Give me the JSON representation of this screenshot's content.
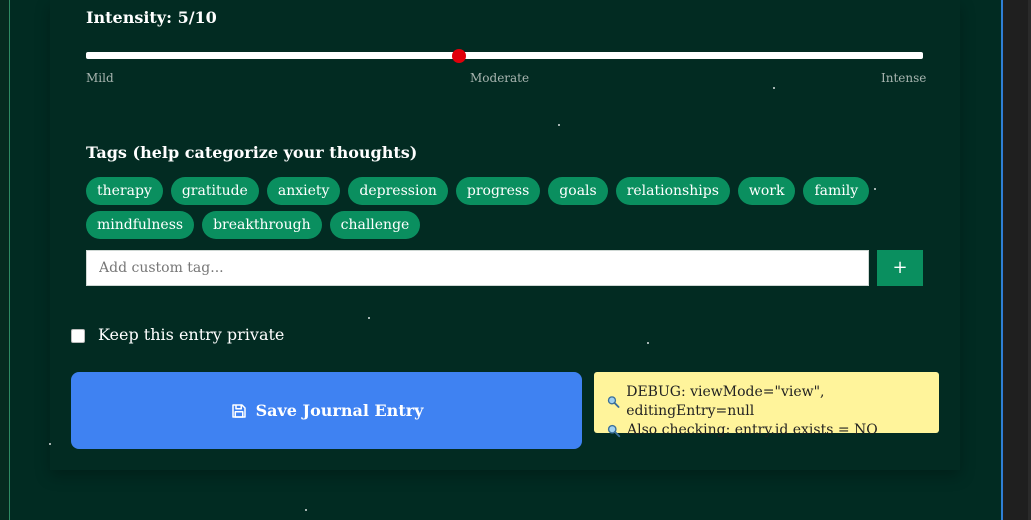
{
  "intensity": {
    "label": "Intensity: 5/10",
    "value": 5,
    "max": 10,
    "scale": {
      "min_label": "Mild",
      "mid_label": "Moderate",
      "max_label": "Intense"
    }
  },
  "tags": {
    "heading": "Tags (help categorize your thoughts)",
    "row1": [
      "therapy",
      "gratitude",
      "anxiety",
      "depression",
      "progress",
      "goals",
      "relationships",
      "work",
      "family"
    ],
    "row2": [
      "mindfulness",
      "breakthrough",
      "challenge"
    ],
    "custom_placeholder": "Add custom tag...",
    "add_label": "+"
  },
  "privacy": {
    "label": "Keep this entry private",
    "checked": false
  },
  "save": {
    "label": "Save Journal Entry",
    "icon": "floppy-disk-icon"
  },
  "debug": {
    "line1": "DEBUG: viewMode=\"view\", editingEntry=null",
    "line2": "Also checking: entry.id exists = NO",
    "icon": "magnifier-icon"
  },
  "colors": {
    "background": "#012b22",
    "tag": "#0a8f5f",
    "slider_thumb": "#e0000b",
    "save_button": "#3f82f2",
    "debug_bg": "#fff49b"
  }
}
